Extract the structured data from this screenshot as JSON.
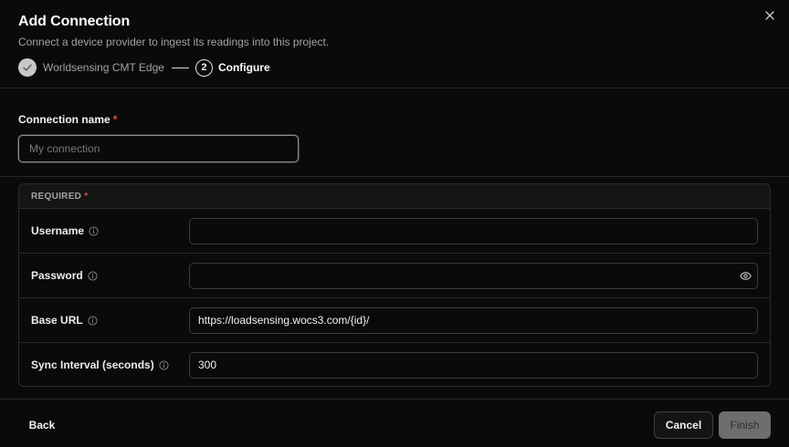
{
  "dialog": {
    "title": "Add Connection",
    "subtitle": "Connect a device provider to ingest its readings into this project.",
    "close_icon": "close-icon"
  },
  "stepper": {
    "steps": [
      {
        "label": "Worldsensing CMT Edge",
        "status": "completed",
        "indicator_icon": "check-icon"
      },
      {
        "number": "2",
        "label": "Configure",
        "status": "current"
      }
    ]
  },
  "connection_name": {
    "label": "Connection name",
    "required_marker": "*",
    "value": "",
    "placeholder": "My connection"
  },
  "required_section": {
    "heading": "REQUIRED",
    "required_marker": "*",
    "fields": [
      {
        "label": "Username",
        "value": "",
        "info_icon": "info-icon"
      },
      {
        "label": "Password",
        "value": "",
        "info_icon": "info-icon",
        "toggle_icon": "eye-icon"
      },
      {
        "label": "Base URL",
        "value": "https://loadsensing.wocs3.com/{id}/",
        "info_icon": "info-icon"
      },
      {
        "label": "Sync Interval (seconds)",
        "value": "300",
        "info_icon": "info-icon"
      }
    ]
  },
  "footer": {
    "back_label": "Back",
    "cancel_label": "Cancel",
    "finish_label": "Finish",
    "finish_disabled": true
  },
  "colors": {
    "background": "#0a0a0a",
    "required_star": "#f04848",
    "border": "#2a2a2a",
    "finish_disabled_bg": "#6e6e6e"
  }
}
